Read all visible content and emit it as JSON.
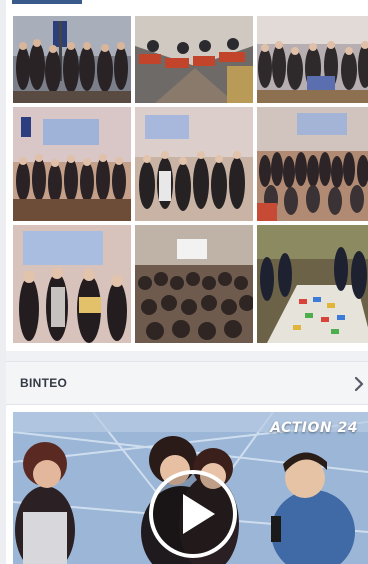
{
  "colors": {
    "accent": "#3b5a8c",
    "section_bg": "#f4f5f7",
    "text": "#333a45"
  },
  "gallery": {
    "photos": [
      {
        "name": "group-photo-stage-flags",
        "icon": "photo"
      },
      {
        "name": "auditorium-seats-photo",
        "icon": "photo"
      },
      {
        "name": "group-photo-hall",
        "icon": "photo"
      },
      {
        "name": "students-with-flag-photo",
        "icon": "photo"
      },
      {
        "name": "students-posing-photo",
        "icon": "photo"
      },
      {
        "name": "large-group-photo",
        "icon": "photo"
      },
      {
        "name": "award-presentation-photo",
        "icon": "photo"
      },
      {
        "name": "audience-screen-photo",
        "icon": "photo"
      },
      {
        "name": "floor-game-photo",
        "icon": "photo"
      }
    ]
  },
  "videos_section": {
    "title": "ΒΙΝΤΕΟ",
    "chevron_icon": "chevron-right-icon"
  },
  "video_player": {
    "channel_logo": "ACTION 24",
    "play_icon": "play-icon"
  }
}
